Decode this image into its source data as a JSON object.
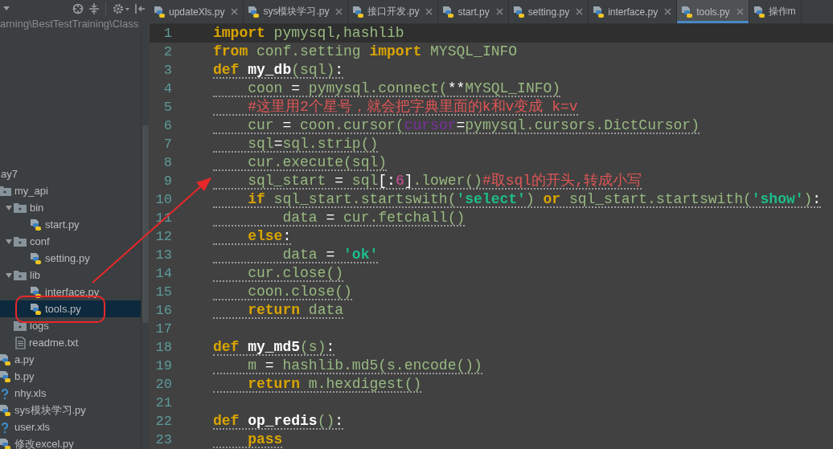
{
  "sidebar": {
    "path": "arning\\BestTestTraining\\Class",
    "tree": [
      {
        "label": "ay7",
        "children": [
          {
            "label": "my_api",
            "kind": "folder",
            "children": [
              {
                "label": "bin",
                "kind": "folder",
                "expanded": true,
                "children": [
                  {
                    "label": "start.py",
                    "kind": "python",
                    "selected": false
                  }
                ]
              },
              {
                "label": "conf",
                "kind": "folder",
                "expanded": true,
                "children": [
                  {
                    "label": "setting.py",
                    "kind": "python",
                    "selected": false
                  }
                ]
              },
              {
                "label": "lib",
                "kind": "folder",
                "expanded": true,
                "children": [
                  {
                    "label": "interface.py",
                    "kind": "python",
                    "selected": false
                  },
                  {
                    "label": "tools.py",
                    "kind": "python",
                    "selected": true
                  }
                ]
              },
              {
                "label": "logs",
                "kind": "folder"
              },
              {
                "label": "readme.txt",
                "kind": "text",
                "selected": false
              }
            ]
          },
          {
            "label": "a.py",
            "kind": "python",
            "selected": false
          },
          {
            "label": "b.py",
            "kind": "python",
            "selected": false
          },
          {
            "label": "nhy.xls",
            "kind": "unknown",
            "selected": false
          },
          {
            "label": "sys模块学习.py",
            "kind": "python",
            "selected": false
          },
          {
            "label": "user.xls",
            "kind": "unknown",
            "selected": false
          },
          {
            "label": "修改excel.py",
            "kind": "python",
            "selected": false
          }
        ]
      }
    ]
  },
  "tabs": [
    {
      "label": "updateXls.py",
      "selected": false,
      "closable": true
    },
    {
      "label": "sys模块学习.py",
      "selected": false,
      "closable": true
    },
    {
      "label": "接口开发.py",
      "selected": false,
      "closable": true
    },
    {
      "label": "start.py",
      "selected": false,
      "closable": true
    },
    {
      "label": "setting.py",
      "selected": false,
      "closable": true
    },
    {
      "label": "interface.py",
      "selected": false,
      "closable": true
    },
    {
      "label": "tools.py",
      "selected": true,
      "closable": true
    },
    {
      "label": "操作m",
      "selected": false,
      "closable": false
    }
  ],
  "code": [
    {
      "number": "1",
      "current": true,
      "underlined": false,
      "tokens": [
        {
          "kind": "kw",
          "text": "import"
        },
        {
          "kind": "plain",
          "text": " pymysql,hashlib"
        }
      ]
    },
    {
      "number": "2",
      "current": false,
      "underlined": false,
      "tokens": [
        {
          "kind": "kw",
          "text": "from"
        },
        {
          "kind": "plain",
          "text": " conf.setting "
        },
        {
          "kind": "kw",
          "text": "import"
        },
        {
          "kind": "plain",
          "text": " MYSQL_INFO"
        }
      ]
    },
    {
      "number": "3",
      "current": false,
      "underlined": true,
      "tokens": [
        {
          "kind": "kw",
          "text": "def "
        },
        {
          "kind": "fn",
          "text": "my_db"
        },
        {
          "kind": "plain",
          "text": "(sql)"
        },
        {
          "kind": "op",
          "text": ":"
        }
      ]
    },
    {
      "number": "4",
      "current": false,
      "underlined": true,
      "tokens": [
        {
          "kind": "plain",
          "text": "    coon "
        },
        {
          "kind": "op",
          "text": "="
        },
        {
          "kind": "plain",
          "text": " pymysql.connect("
        },
        {
          "kind": "op",
          "text": "**"
        },
        {
          "kind": "plain",
          "text": "MYSQL_INFO)"
        }
      ]
    },
    {
      "number": "5",
      "current": false,
      "underlined": true,
      "tokens": [
        {
          "kind": "comment",
          "text": "    #这里用2个星号，就会把字典里面的k和v变成 k=v"
        }
      ]
    },
    {
      "number": "6",
      "current": false,
      "underlined": true,
      "tokens": [
        {
          "kind": "plain",
          "text": "    cur "
        },
        {
          "kind": "op",
          "text": "="
        },
        {
          "kind": "plain",
          "text": " coon.cursor("
        },
        {
          "kind": "param",
          "text": "cursor"
        },
        {
          "kind": "op",
          "text": "="
        },
        {
          "kind": "plain",
          "text": "pymysql.cursors.DictCursor)"
        }
      ]
    },
    {
      "number": "7",
      "current": false,
      "underlined": true,
      "tokens": [
        {
          "kind": "plain",
          "text": "    sql"
        },
        {
          "kind": "op",
          "text": "="
        },
        {
          "kind": "plain",
          "text": "sql.strip()"
        }
      ]
    },
    {
      "number": "8",
      "current": false,
      "underlined": true,
      "tokens": [
        {
          "kind": "plain",
          "text": "    cur.execute(sql)"
        }
      ]
    },
    {
      "number": "9",
      "current": false,
      "underlined": true,
      "tokens": [
        {
          "kind": "plain",
          "text": "    sql_start "
        },
        {
          "kind": "op",
          "text": "="
        },
        {
          "kind": "plain",
          "text": " sql"
        },
        {
          "kind": "op",
          "text": "[:"
        },
        {
          "kind": "num",
          "text": "6"
        },
        {
          "kind": "op",
          "text": "]"
        },
        {
          "kind": "plain",
          "text": ".lower()"
        },
        {
          "kind": "comment",
          "text": "#取sql的开头,转成小写"
        }
      ]
    },
    {
      "number": "10",
      "current": false,
      "underlined": true,
      "tokens": [
        {
          "kind": "kw",
          "text": "    if"
        },
        {
          "kind": "plain",
          "text": " sql_start.startswith("
        },
        {
          "kind": "str",
          "text": "'select'"
        },
        {
          "kind": "plain",
          "text": ") "
        },
        {
          "kind": "kw",
          "text": "or"
        },
        {
          "kind": "plain",
          "text": " sql_start.startswith("
        },
        {
          "kind": "str",
          "text": "'show'"
        },
        {
          "kind": "plain",
          "text": ")"
        },
        {
          "kind": "op",
          "text": ":"
        }
      ]
    },
    {
      "number": "11",
      "current": false,
      "underlined": true,
      "tokens": [
        {
          "kind": "plain",
          "text": "        data "
        },
        {
          "kind": "op",
          "text": "="
        },
        {
          "kind": "plain",
          "text": " cur.fetchall()"
        }
      ]
    },
    {
      "number": "12",
      "current": false,
      "underlined": true,
      "tokens": [
        {
          "kind": "kw",
          "text": "    else"
        },
        {
          "kind": "op",
          "text": ":"
        }
      ]
    },
    {
      "number": "13",
      "current": false,
      "underlined": true,
      "tokens": [
        {
          "kind": "plain",
          "text": "        data "
        },
        {
          "kind": "op",
          "text": "= "
        },
        {
          "kind": "str",
          "text": "'ok'"
        }
      ]
    },
    {
      "number": "14",
      "current": false,
      "underlined": true,
      "tokens": [
        {
          "kind": "plain",
          "text": "    cur.close()"
        }
      ]
    },
    {
      "number": "15",
      "current": false,
      "underlined": true,
      "tokens": [
        {
          "kind": "plain",
          "text": "    coon.close()"
        }
      ]
    },
    {
      "number": "16",
      "current": false,
      "underlined": true,
      "tokens": [
        {
          "kind": "kw",
          "text": "    return"
        },
        {
          "kind": "plain",
          "text": " data"
        }
      ]
    },
    {
      "number": "17",
      "current": false
    },
    {
      "number": "18",
      "current": false,
      "underlined": true,
      "tokens": [
        {
          "kind": "kw",
          "text": "def "
        },
        {
          "kind": "fn",
          "text": "my_md5"
        },
        {
          "kind": "plain",
          "text": "(s)"
        },
        {
          "kind": "op",
          "text": ":"
        }
      ]
    },
    {
      "number": "19",
      "current": false,
      "underlined": true,
      "tokens": [
        {
          "kind": "plain",
          "text": "    m "
        },
        {
          "kind": "op",
          "text": "="
        },
        {
          "kind": "plain",
          "text": " hashlib.md5(s.encode())"
        }
      ]
    },
    {
      "number": "20",
      "current": false,
      "underlined": true,
      "tokens": [
        {
          "kind": "kw",
          "text": "    return"
        },
        {
          "kind": "plain",
          "text": " m.hexdigest()"
        }
      ]
    },
    {
      "number": "21",
      "current": false
    },
    {
      "number": "22",
      "current": false,
      "underlined": true,
      "tokens": [
        {
          "kind": "kw",
          "text": "def "
        },
        {
          "kind": "fn",
          "text": "op_redis"
        },
        {
          "kind": "plain",
          "text": "()"
        },
        {
          "kind": "op",
          "text": ":"
        }
      ]
    },
    {
      "number": "23",
      "current": false,
      "underlined": true,
      "tokens": [
        {
          "kind": "kw",
          "text": "    pass"
        }
      ]
    }
  ]
}
